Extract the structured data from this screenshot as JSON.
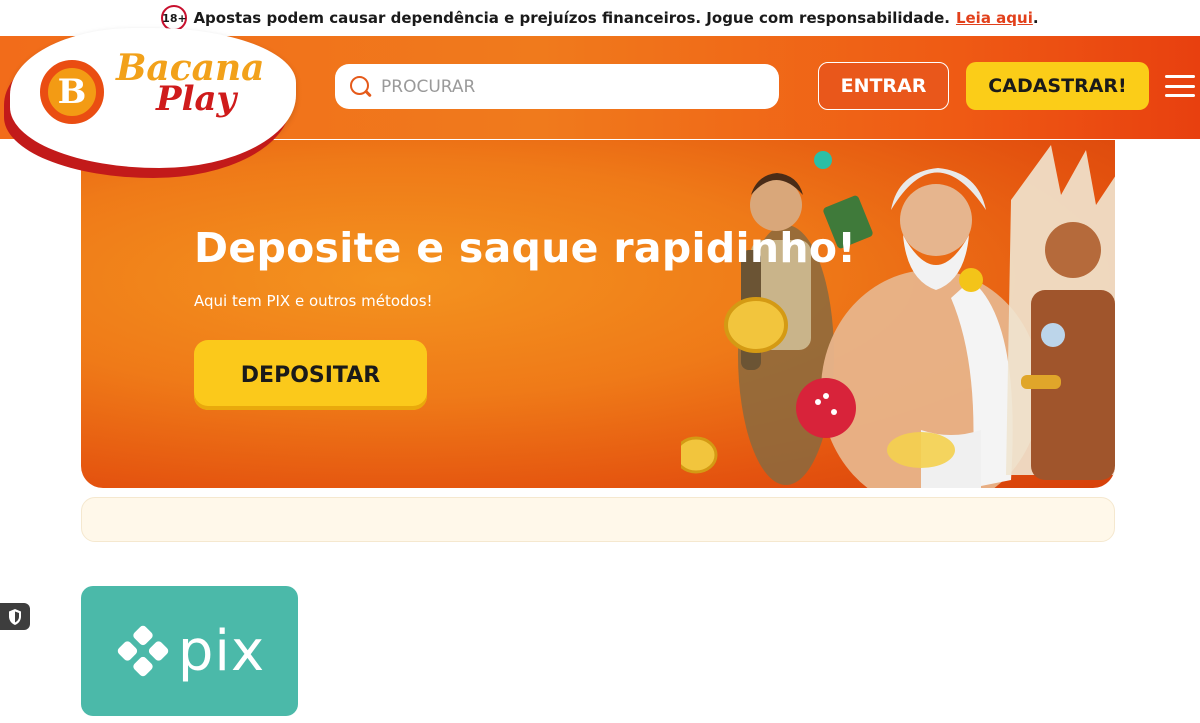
{
  "warning_bar": {
    "age_badge": "18+",
    "message": "Apostas podem causar dependência e prejuízos financeiros. Jogue com responsabilidade.",
    "link_text": "Leia aqui",
    "trailing": "."
  },
  "header": {
    "logo_mark": "B",
    "logo_line1": "Bacana",
    "logo_line2": "Play",
    "search_placeholder": "PROCURAR",
    "login_label": "ENTRAR",
    "register_label": "CADASTRAR!"
  },
  "banner": {
    "title": "Deposite e saque rapidinho!",
    "subtitle": "Aqui tem PIX e outros métodos!",
    "cta_label": "DEPOSITAR"
  },
  "payment_methods": [
    {
      "label": "pix"
    }
  ],
  "colors": {
    "header_orange": "#f07a1c",
    "cta_yellow": "#fbc91b",
    "pix_teal": "#4bb9a9",
    "link_red": "#e2401b"
  }
}
